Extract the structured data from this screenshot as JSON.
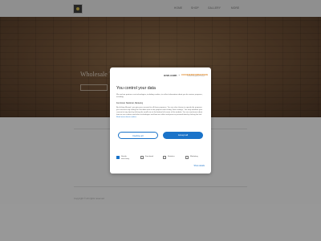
{
  "nav": {
    "items": [
      {
        "label": "HOME"
      },
      {
        "label": "SHOP"
      },
      {
        "label": "GALLERY"
      },
      {
        "label": "MORE"
      }
    ]
  },
  "hero": {
    "title": "Wholesale Timber Supplier"
  },
  "footer": {
    "text": "Copyright © All rights reserved"
  },
  "consent": {
    "brand": {
      "onecom": "one.com",
      "plus": "+",
      "cookiewise": "COOKIEINFORMATION",
      "cookiewise_sub": "Consent Management Platform"
    },
    "title": "You control your data",
    "intro": "We and our partners use technologies, including cookies, to collect information about you for various purposes, including:",
    "purposes": "Functional, Statistical, Marketing",
    "body": "By clicking 'Accept', you give your consent for all these purposes. You can also choose to specify the purposes you consent to by ticking the checkbox next to the purpose and clicking 'Save settings'. You may withdraw your consent at any time by clicking the small icon at the bottom left corner of the website. You can read more about how we use cookies and other technologies and how we collect and process personal data by clicking the link.",
    "read_more": "Read more about cookies",
    "decline_label": "Decline all",
    "accept_label": "Accept all",
    "categories": [
      {
        "label": "Strictly necessary",
        "checked": true
      },
      {
        "label": "Functional",
        "checked": false
      },
      {
        "label": "Statistics",
        "checked": false
      },
      {
        "label": "Marketing",
        "checked": false
      }
    ],
    "show_details": "Show details"
  }
}
